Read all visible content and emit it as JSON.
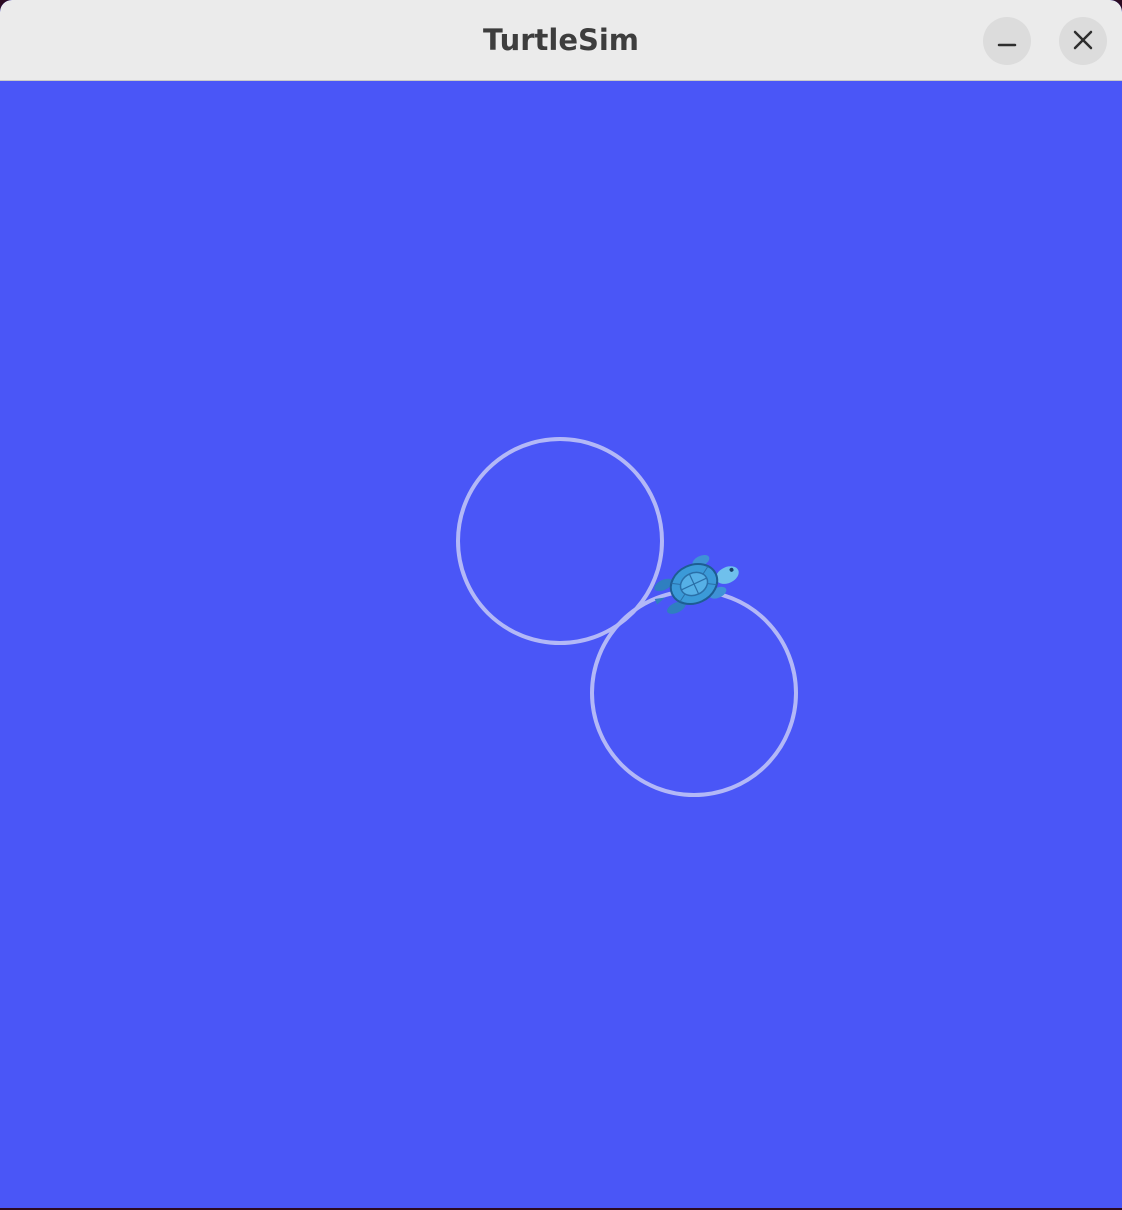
{
  "window": {
    "title": "TurtleSim",
    "controls": {
      "minimize_icon": "minimize-icon",
      "close_icon": "close-icon"
    }
  },
  "canvas": {
    "background_color": "#4a56f7",
    "trail_color": "#b3b8f7",
    "turtle_color": "#4aa6e0"
  }
}
